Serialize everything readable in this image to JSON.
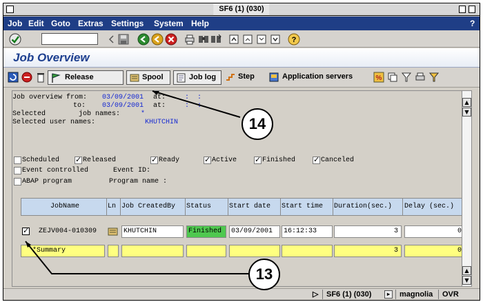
{
  "window": {
    "title": "SF6 (1) (030)"
  },
  "menu": {
    "items": [
      "Job",
      "Edit",
      "Goto",
      "Extras",
      "Settings",
      "System",
      "Help"
    ],
    "help_right": "?"
  },
  "screen": {
    "title": "Job Overview"
  },
  "app_toolbar": {
    "release_label": "Release",
    "spool_label": "Spool",
    "joblog_label": "Job log",
    "step_label": "Step",
    "appservers_label": "Application servers"
  },
  "criteria": {
    "line1_label": "Job overview from:",
    "line1_date": "03/09/2001",
    "line1_at": "at:",
    "line1_time": ":  :",
    "line2_label": "to:",
    "line2_date": "03/09/2001",
    "line2_at": "at:",
    "line2_time": ":  :",
    "line3_label": "Selected        job names:",
    "line3_value": "*",
    "line4_label": "Selected user names:",
    "line4_value": "KHUTCHIN"
  },
  "status_filters": {
    "scheduled": "Scheduled",
    "released": "Released",
    "ready": "Ready",
    "active": "Active",
    "finished": "Finished",
    "canceled": "Canceled",
    "event_controlled": "Event controlled",
    "event_id": "Event ID:",
    "abap_program": "ABAP program",
    "program_name": "Program name :"
  },
  "grid": {
    "headers": [
      "JobName",
      "Ln",
      "Job CreatedBy",
      "Status",
      "Start date",
      "Start time",
      "Duration(sec.)",
      "Delay (sec.)"
    ],
    "row": {
      "jobname": "ZEJV004-010309",
      "created_by": "KHUTCHIN",
      "status": "Finished",
      "start_date": "03/09/2001",
      "start_time": "16:12:33",
      "duration": "3",
      "delay": "0"
    },
    "summary": {
      "label": "*Summary",
      "duration": "3",
      "delay": "0"
    }
  },
  "statusbar": {
    "system": "SF6 (1) (030)",
    "server": "magnolia",
    "mode": "OVR"
  },
  "callouts": {
    "a": "14",
    "b": "13"
  },
  "colors": {
    "menu_bg": "#1f3e86",
    "title_text": "#1d3f8f",
    "status_finished": "#4fc84f",
    "summary_yellow": "#ffff80",
    "value_blue": "#1428d2"
  }
}
